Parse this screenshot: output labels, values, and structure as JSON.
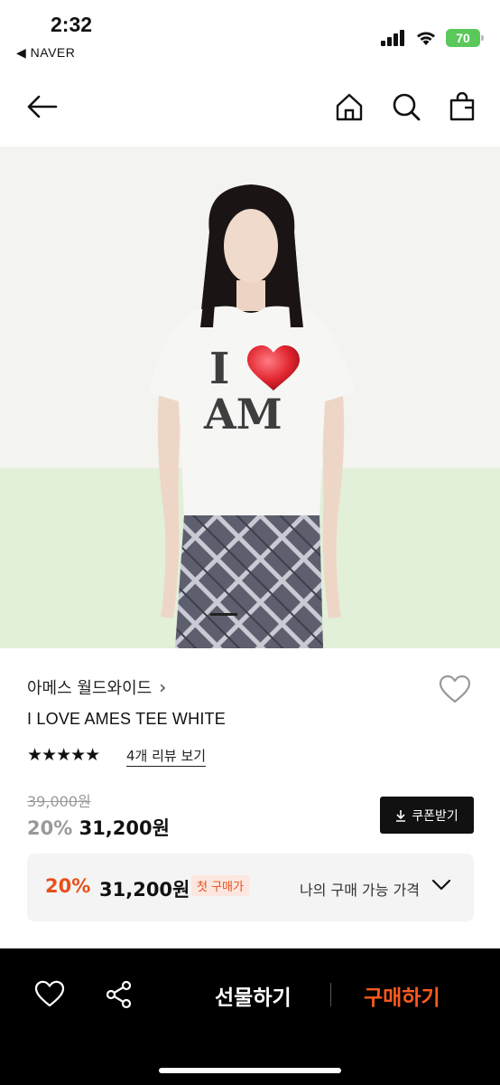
{
  "status_bar": {
    "time": "2:32",
    "back_app": "NAVER",
    "battery": "70",
    "icons": [
      "signal-icon",
      "wifi-icon",
      "battery-icon"
    ]
  },
  "nav": {
    "icons": [
      "back-arrow-icon",
      "home-icon",
      "search-icon",
      "shopping-bag-icon"
    ]
  },
  "product_image": {
    "shirt_text_line1": "I",
    "shirt_text_line2": "AM",
    "slide_indicator": "1"
  },
  "product": {
    "brand": "아메스 월드와이드",
    "brand_chevron": "›",
    "name": "I LOVE AMES TEE WHITE",
    "rating_stars": "★★★★★",
    "rating": 5,
    "review_link": "4개 리뷰 보기",
    "original_price": "39,000원",
    "discount_percent": "20%",
    "sale_price": "31,200원",
    "coupon_button": "쿠폰받기"
  },
  "best_price": {
    "discount_percent": "20%",
    "price": "31,200원",
    "badge": "첫 구매가",
    "my_price_label": "나의 구매 가능 가격"
  },
  "bottom_bar": {
    "gift_label": "선물하기",
    "buy_label": "구매하기"
  },
  "colors": {
    "accent_orange": "#e8501a",
    "buy_orange": "#ff5a1f",
    "battery_green": "#5ac85a",
    "bottom_bar_bg": "#000000"
  }
}
